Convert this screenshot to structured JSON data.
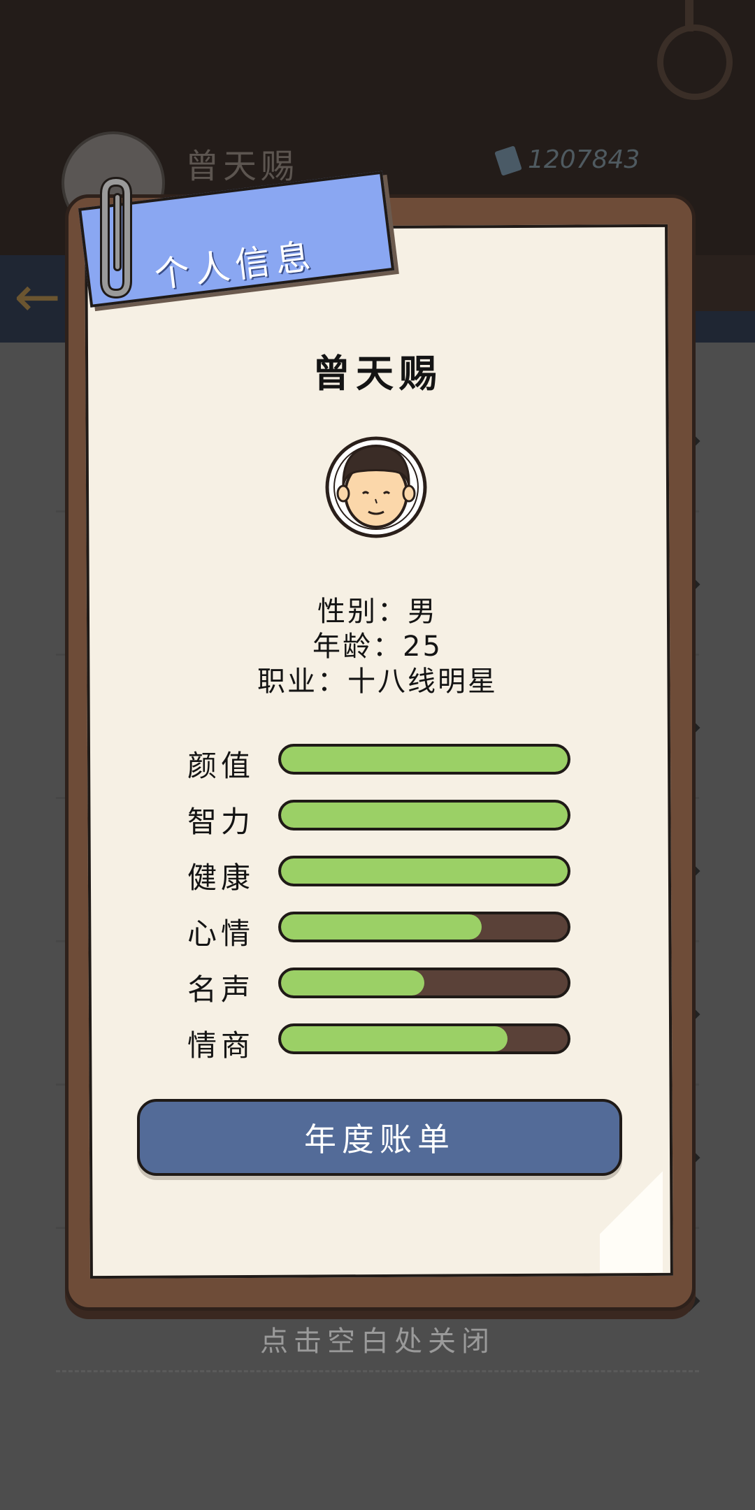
{
  "background": {
    "player_name": "曾天赐",
    "money": "1207843",
    "close_hint": "点击空白处关闭"
  },
  "panel": {
    "title": "个人信息",
    "name": "曾天赐",
    "gender_line": "性别：男",
    "age_line": "年龄：25",
    "job_line": "职业：十八线明星",
    "stats": [
      {
        "label": "颜值",
        "value": 1.0
      },
      {
        "label": "智力",
        "value": 1.0
      },
      {
        "label": "健康",
        "value": 1.0
      },
      {
        "label": "心情",
        "value": 0.7
      },
      {
        "label": "名声",
        "value": 0.5
      },
      {
        "label": "情商",
        "value": 0.79
      }
    ],
    "button_label": "年度账单"
  },
  "colors": {
    "accent_blue": "#8aa7f2",
    "button_blue": "#536b98",
    "bar_green": "#9bd066",
    "bar_track": "#5a4138",
    "board_brown": "#6e4c38"
  },
  "icons": {
    "back": "arrow-left-icon",
    "money": "banknote-icon",
    "clip": "paperclip-icon"
  }
}
